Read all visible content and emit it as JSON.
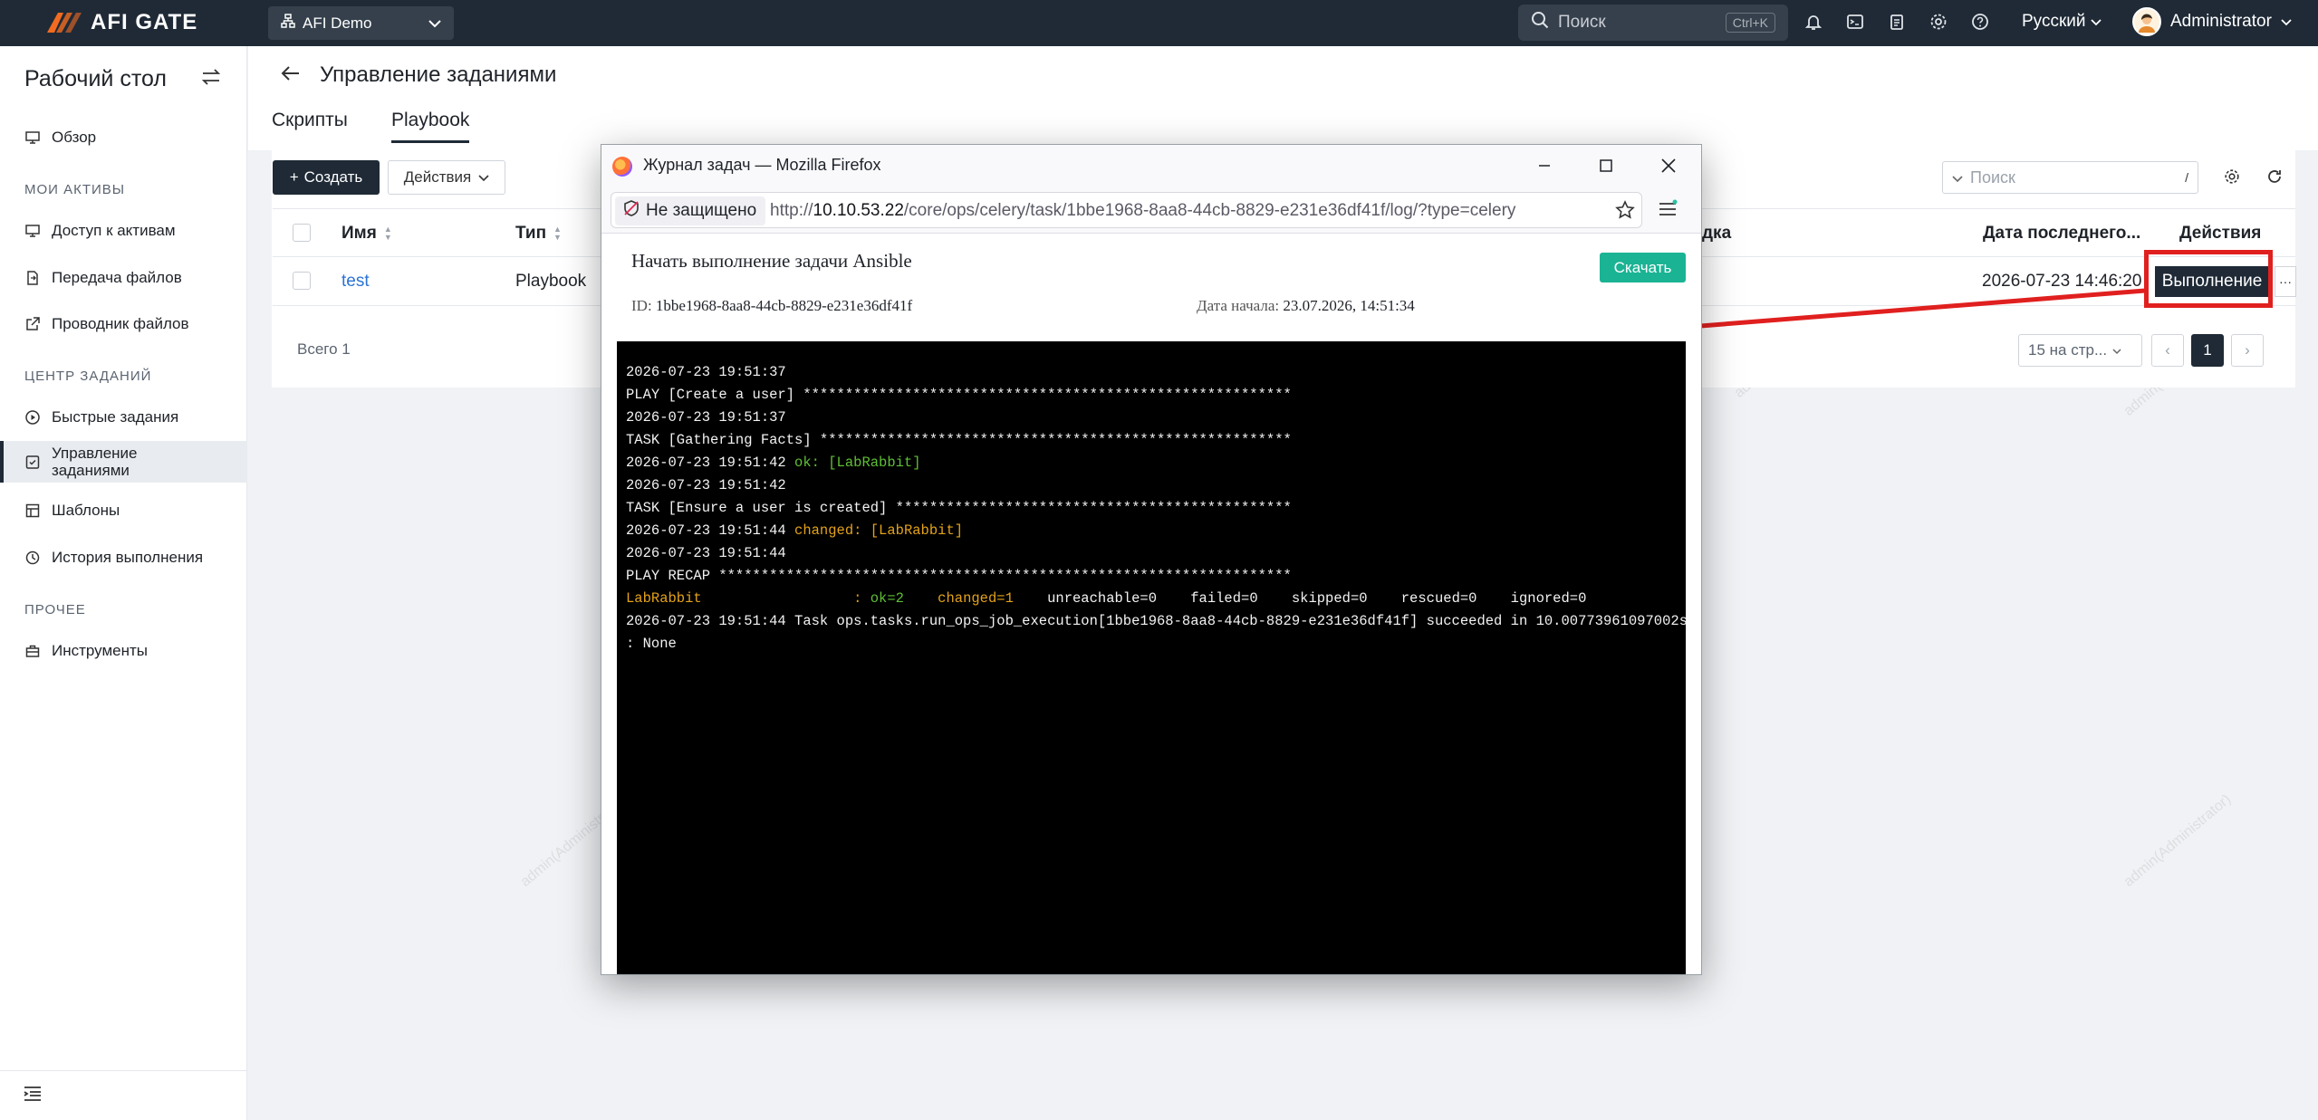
{
  "topbar": {
    "brand": "AFI GATE",
    "org": "AFI Demo",
    "search_placeholder": "Поиск",
    "search_shortcut": "Ctrl+K",
    "language": "Русский",
    "user": "Administrator"
  },
  "sidebar": {
    "title": "Рабочий стол",
    "overview": "Обзор",
    "section_assets": "МОИ АКТИВЫ",
    "asset_access": "Доступ к активам",
    "file_transfer": "Передача файлов",
    "file_explorer": "Проводник файлов",
    "section_jobs": "ЦЕНТР ЗАДАНИЙ",
    "quick_jobs": "Быстрые задания",
    "job_management": "Управление заданиями",
    "templates": "Шаблоны",
    "history": "История выполнения",
    "section_other": "ПРОЧЕЕ",
    "tools": "Инструменты"
  },
  "page": {
    "title": "Управление заданиями",
    "tabs": [
      "Скрипты",
      "Playbook"
    ]
  },
  "toolbar": {
    "create": "Создать",
    "actions": "Действия",
    "search_placeholder": "Поиск",
    "search_shortcut": "/"
  },
  "table": {
    "headers": {
      "name": "Имя",
      "type": "Тип",
      "partial": "дка",
      "last_date": "Дата последнего...",
      "actions": "Действия"
    },
    "rows": [
      {
        "name": "test",
        "type": "Playbook",
        "last_date": "2026-07-23 14:46:20",
        "run": "Выполнение",
        "more": "···"
      }
    ],
    "total": "Всего 1",
    "page_size": "15 на стр...",
    "current_page": "1"
  },
  "firefox": {
    "window_title": "Журнал задач — Mozilla Firefox",
    "security": "Не защищено",
    "url_prefix": "http://",
    "url_host": "10.10.53.22",
    "url_path": "/core/ops/celery/task/1bbe1968-8aa8-44cb-8829-e231e36df41f/log/?type=celery"
  },
  "log": {
    "heading": "Начать выполнение задачи Ansible",
    "download": "Скачать",
    "id_label": "ID:",
    "id_value": "1bbe1968-8aa8-44cb-8829-e231e36df41f",
    "start_label": "Дата начала:",
    "start_value": "23.07.2026, 14:51:34",
    "lines": {
      "l1": "2026-07-23 19:51:37",
      "l2": "PLAY [Create a user] **********************************************************",
      "l3": "2026-07-23 19:51:37",
      "l4": "TASK [Gathering Facts] ********************************************************",
      "l5_ts": "2026-07-23 19:51:42 ",
      "l5_msg": "ok: [LabRabbit]",
      "l6": "2026-07-23 19:51:42",
      "l7": "TASK [Ensure a user is created] ***********************************************",
      "l8_ts": "2026-07-23 19:51:44 ",
      "l8_msg": "changed: [LabRabbit]",
      "l9": "2026-07-23 19:51:44",
      "l10": "PLAY RECAP ********************************************************************",
      "recap_host": "LabRabbit                  : ",
      "recap_ok": "ok=2    ",
      "recap_changed": "changed=1    ",
      "recap_rest": "unreachable=0    failed=0    skipped=0    rescued=0    ignored=0",
      "l12": "2026-07-23 19:51:44 Task ops.tasks.run_ops_job_execution[1bbe1968-8aa8-44cb-8829-e231e36df41f] succeeded in 10.00773961097002s",
      "l13": ": None"
    }
  },
  "watermark": "admin(Administrator)",
  "colors": {
    "topbar": "#1f2a36",
    "primary": "#1f2a36",
    "download": "#1ab394",
    "highlight": "#e0201f",
    "log_ok": "#5fbf34",
    "log_changed": "#e3a21a"
  }
}
